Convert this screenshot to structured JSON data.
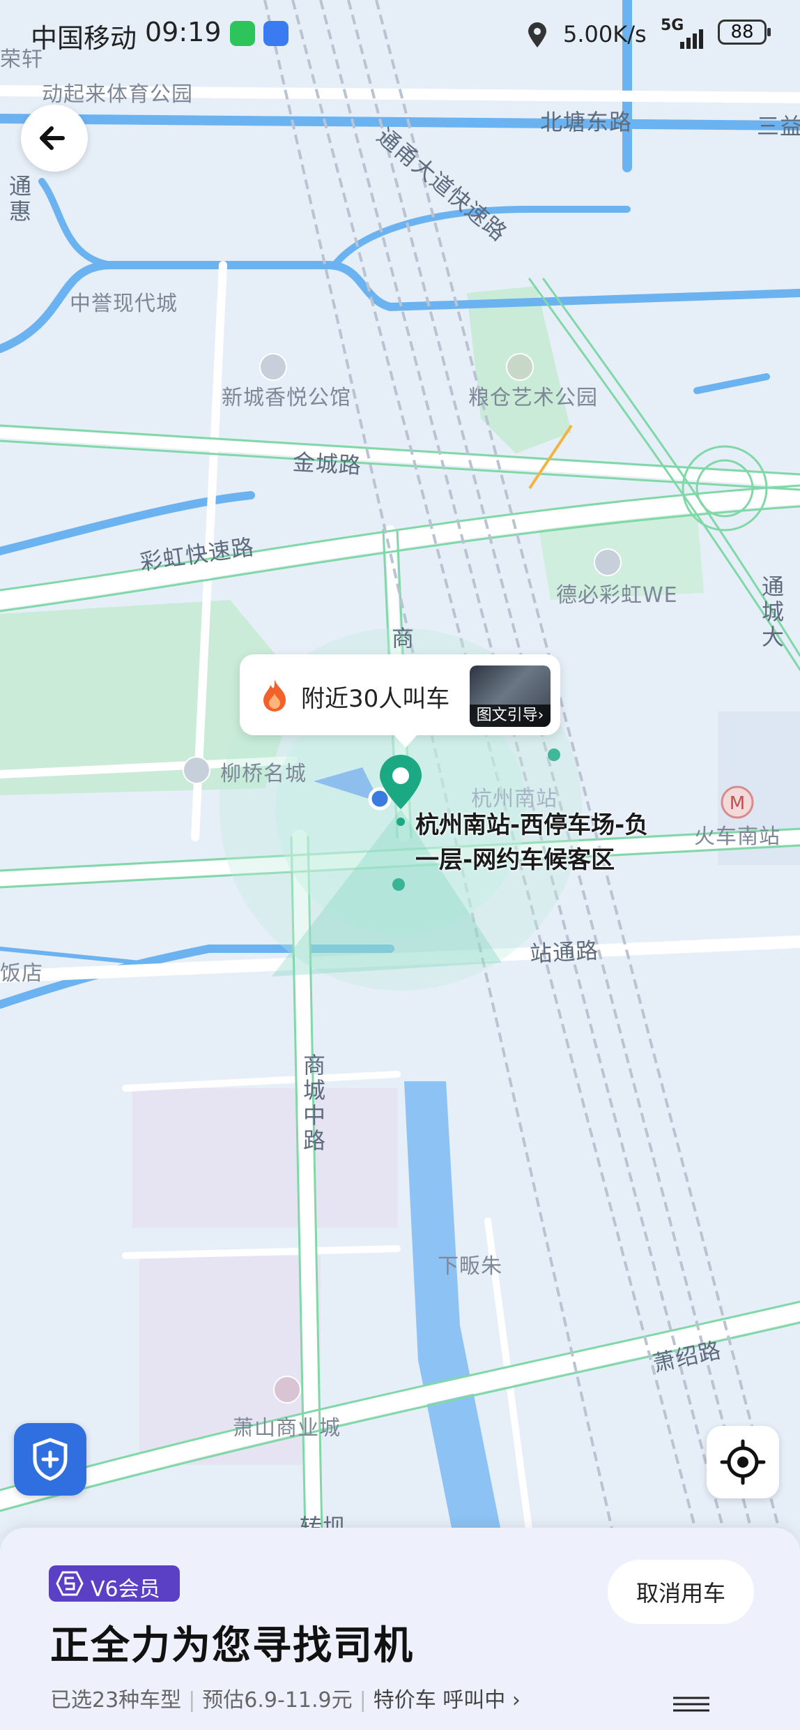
{
  "status_bar": {
    "carrier": "中国移动",
    "time": "09:19",
    "speed": "5.00K/s",
    "network": "5G",
    "battery": "88"
  },
  "map": {
    "roads": {
      "beitang_east": "北塘东路",
      "jincheng": "金城路",
      "caihong_expressway": "彩虹快速路",
      "zhantong": "站通路",
      "shangcheng_middle": "商城中路",
      "xiaoshao": "萧绍路",
      "tongcheng": "通城大",
      "tonghui": "通惠",
      "shang": "商",
      "zhuan": "转坝",
      "tongjian_expressway": "通甬大道快速路"
    },
    "pois": {
      "dongqilai": "动起来体育公园",
      "zhongyu": "中誉现代城",
      "xincheng": "新城香悦公馆",
      "liangcang": "粮仓艺术公园",
      "dexin": "德必彩虹WE",
      "liuqiao": "柳桥名城",
      "hangzhou_south": "杭州南站",
      "train_south": "火车南站",
      "xiafan": "下畈朱",
      "xiaoshan_mall": "萧山商业城",
      "hotel": "饭店",
      "lexuan": "荣轩",
      "three": "三益"
    }
  },
  "callout": {
    "text": "附近30人叫车",
    "guide_label": "图文引导",
    "guide_chevron": "›"
  },
  "pickup": {
    "label": "杭州南站-西停车场-负一层-网约车候客区"
  },
  "panel": {
    "vip_label": "V6会员",
    "cancel_label": "取消用车",
    "title": "正全力为您寻找司机",
    "summary": "已选23种车型",
    "estimate": "预估6.9-11.9元",
    "car_type": "特价车",
    "status": "呼叫中",
    "chevron": "›"
  },
  "icons": {
    "back": "arrow-left-icon",
    "shield": "shield-plus-icon",
    "locate": "locate-target-icon",
    "fire": "fire-icon",
    "metro": "metro-icon",
    "pin": "location-pin-icon"
  },
  "colors": {
    "accent_green": "#1aa983",
    "shield_blue": "#2f6fe0",
    "vip_purple": "#5b3fc4",
    "water": "#6bb2f0",
    "road_green": "#7fd8a6"
  }
}
